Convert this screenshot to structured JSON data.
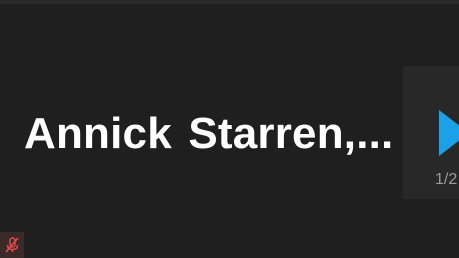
{
  "participant": {
    "display_name": "Annick Starren,..."
  },
  "pagination": {
    "indicator": "1/2"
  },
  "icons": {
    "next": "chevron-right-icon",
    "mic_muted": "mic-muted-icon"
  },
  "colors": {
    "background": "#1f1f1f",
    "accent": "#1aa1e8",
    "muted": "#e04a4a"
  }
}
